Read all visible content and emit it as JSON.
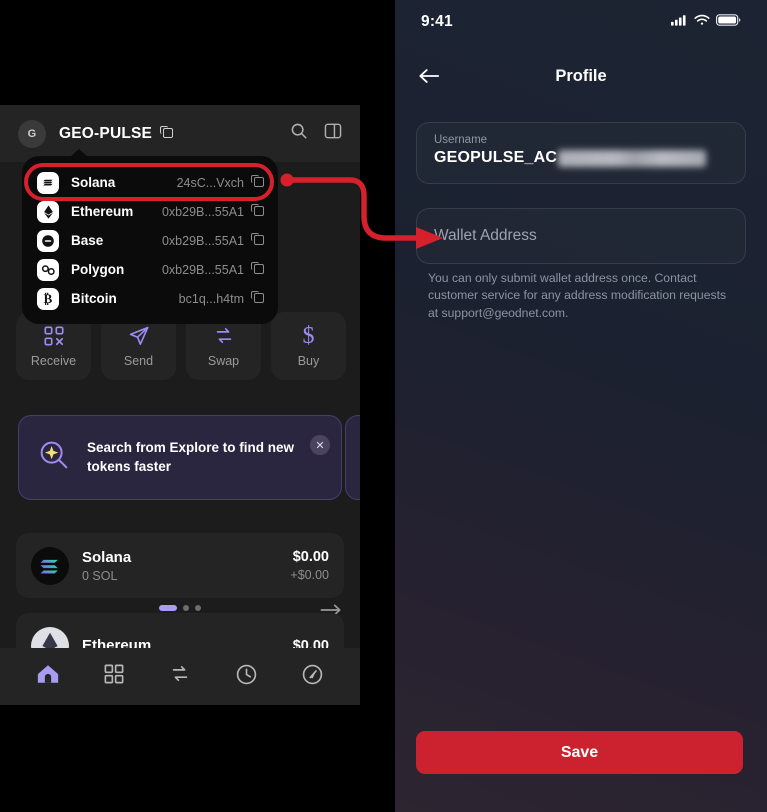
{
  "left_app": {
    "header": {
      "avatar_initial": "G",
      "wallet_name": "GEO-PULSE",
      "copy_icon": "copy-icon",
      "search_icon": "search-icon",
      "panel_icon": "sidebar-panel-icon"
    },
    "network_dropdown": {
      "items": [
        {
          "name": "Solana",
          "address": "24sC...Vxch",
          "icon": "solana-icon",
          "selected": true
        },
        {
          "name": "Ethereum",
          "address": "0xb29B...55A1",
          "icon": "ethereum-icon",
          "selected": false
        },
        {
          "name": "Base",
          "address": "0xb29B...55A1",
          "icon": "base-icon",
          "selected": false
        },
        {
          "name": "Polygon",
          "address": "0xb29B...55A1",
          "icon": "polygon-icon",
          "selected": false
        },
        {
          "name": "Bitcoin",
          "address": "bc1q...h4tm",
          "icon": "bitcoin-icon",
          "selected": false
        }
      ]
    },
    "actions": [
      {
        "label": "Receive",
        "icon": "qr-code-icon"
      },
      {
        "label": "Send",
        "icon": "paper-plane-icon"
      },
      {
        "label": "Swap",
        "icon": "swap-arrows-icon"
      },
      {
        "label": "Buy",
        "icon": "dollar-sign-icon"
      }
    ],
    "promo": {
      "text": "Search from Explore to find new tokens faster",
      "icon": "search-sparkle-icon",
      "close_icon": "close-icon",
      "next_icon": "arrow-right-icon",
      "dots": 3,
      "active_dot": 0
    },
    "tokens": [
      {
        "name": "Solana",
        "amount": "0 SOL",
        "value": "$0.00",
        "change": "+$0.00",
        "logo": "solana-token-logo"
      },
      {
        "name": "Ethereum",
        "amount": "",
        "value": "$0.00",
        "change": "",
        "logo": "ethereum-token-logo"
      }
    ],
    "bottom_nav": [
      {
        "icon": "home-icon",
        "active": true
      },
      {
        "icon": "grid-icon",
        "active": false
      },
      {
        "icon": "swap-icon",
        "active": false
      },
      {
        "icon": "history-icon",
        "active": false
      },
      {
        "icon": "compass-icon",
        "active": false
      }
    ]
  },
  "right_app": {
    "status_bar": {
      "time": "9:41",
      "signal_icon": "cellular-signal-icon",
      "wifi_icon": "wifi-icon",
      "battery_icon": "battery-icon"
    },
    "nav": {
      "back_icon": "back-arrow-icon",
      "title": "Profile"
    },
    "username_field": {
      "label": "Username",
      "value": "GEOPULSE_AC",
      "redacted": true
    },
    "wallet_field": {
      "placeholder": "Wallet Address",
      "value": ""
    },
    "helper_text": "You can only submit wallet address once. Contact customer service for any address modification requests at support@geodnet.com.",
    "save_button": "Save"
  },
  "annotation": {
    "highlight_target": "Solana",
    "arrow_target": "Wallet Address",
    "color": "#d6202b"
  }
}
